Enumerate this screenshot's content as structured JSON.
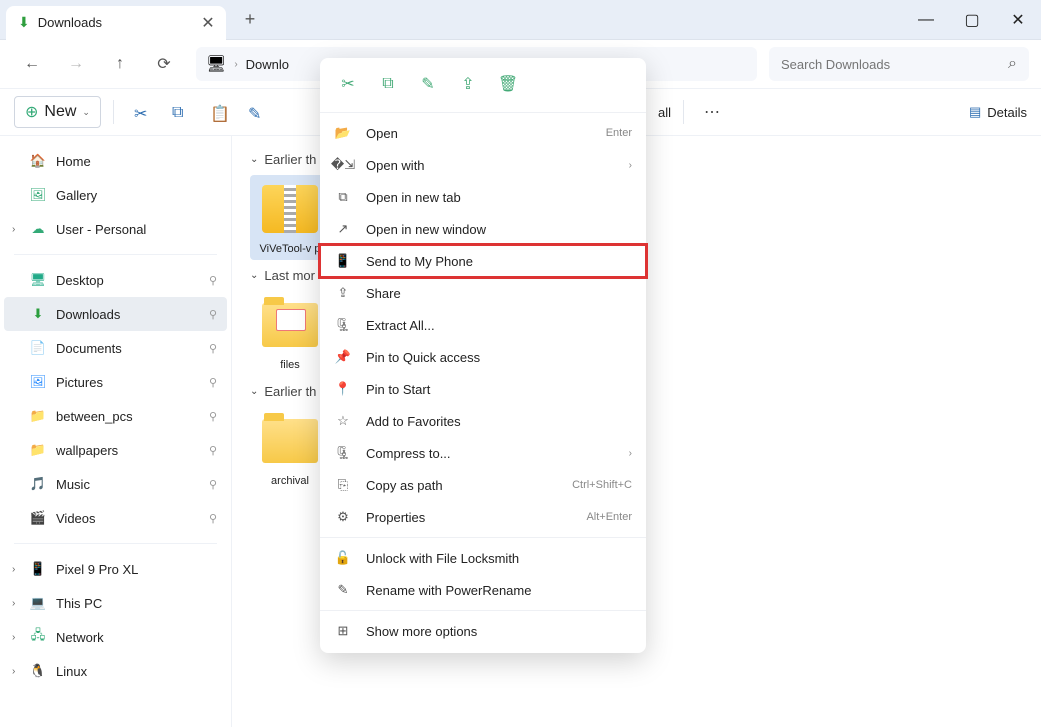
{
  "tab": {
    "title": "Downloads"
  },
  "winbtns": {
    "min": "—",
    "max": "▢",
    "close": "✕"
  },
  "breadcrumb": {
    "locationIcon": "🖥",
    "part": "Downlo"
  },
  "search": {
    "placeholder": "Search Downloads"
  },
  "toolbar": {
    "new": "New",
    "all": "all",
    "details": "Details"
  },
  "sidebar": {
    "top": [
      {
        "icon": "🏠",
        "label": "Home"
      },
      {
        "icon": "🖼",
        "label": "Gallery"
      },
      {
        "icon": "☁",
        "label": "User - Personal",
        "expandable": true
      }
    ],
    "pinned": [
      {
        "icon": "🖥",
        "label": "Desktop",
        "color": "#2a8"
      },
      {
        "icon": "⬇",
        "label": "Downloads",
        "selected": true,
        "color": "#2b9e3e"
      },
      {
        "icon": "📄",
        "label": "Documents",
        "color": "#888"
      },
      {
        "icon": "🖼",
        "label": "Pictures",
        "color": "#2a8cff"
      },
      {
        "icon": "📁",
        "label": "between_pcs",
        "color": "#f7c948"
      },
      {
        "icon": "📁",
        "label": "wallpapers",
        "color": "#f7c948"
      },
      {
        "icon": "🎵",
        "label": "Music",
        "color": "#c23"
      },
      {
        "icon": "🎬",
        "label": "Videos",
        "color": "#83c"
      }
    ],
    "drives": [
      {
        "icon": "📱",
        "label": "Pixel 9 Pro XL",
        "expandable": true
      },
      {
        "icon": "💻",
        "label": "This PC",
        "expandable": true
      },
      {
        "icon": "🖧",
        "label": "Network",
        "expandable": true
      },
      {
        "icon": "🐧",
        "label": "Linux",
        "expandable": true
      }
    ]
  },
  "groups": [
    {
      "header": "Earlier th",
      "files": [
        {
          "name": "ViVeTool-v p",
          "type": "zip",
          "selected": true
        }
      ]
    },
    {
      "header": "Last mor",
      "files": [
        {
          "name": "files",
          "type": "folderfile"
        }
      ]
    },
    {
      "header": "Earlier th",
      "files": [
        {
          "name": "archival",
          "type": "folder"
        }
      ]
    }
  ],
  "ctxmenu": {
    "topIcons": [
      "cut",
      "copy",
      "rename",
      "share",
      "delete"
    ],
    "items": [
      {
        "icon": "📂",
        "label": "Open",
        "hint": "Enter"
      },
      {
        "icon": "�⇲",
        "label": "Open with",
        "sub": true
      },
      {
        "icon": "⧉",
        "label": "Open in new tab"
      },
      {
        "icon": "↗",
        "label": "Open in new window"
      },
      {
        "icon": "📱",
        "label": "Send to My Phone",
        "highlight": true
      },
      {
        "icon": "⇪",
        "label": "Share"
      },
      {
        "icon": "🗜",
        "label": "Extract All..."
      },
      {
        "icon": "📌",
        "label": "Pin to Quick access"
      },
      {
        "icon": "📍",
        "label": "Pin to Start"
      },
      {
        "icon": "☆",
        "label": "Add to Favorites"
      },
      {
        "icon": "🗜",
        "label": "Compress to...",
        "sub": true
      },
      {
        "icon": "⎘",
        "label": "Copy as path",
        "hint": "Ctrl+Shift+C"
      },
      {
        "icon": "⚙",
        "label": "Properties",
        "hint": "Alt+Enter"
      }
    ],
    "powerItems": [
      {
        "icon": "🔓",
        "label": "Unlock with File Locksmith"
      },
      {
        "icon": "✎",
        "label": "Rename with PowerRename"
      }
    ],
    "more": {
      "icon": "⊞",
      "label": "Show more options"
    }
  }
}
